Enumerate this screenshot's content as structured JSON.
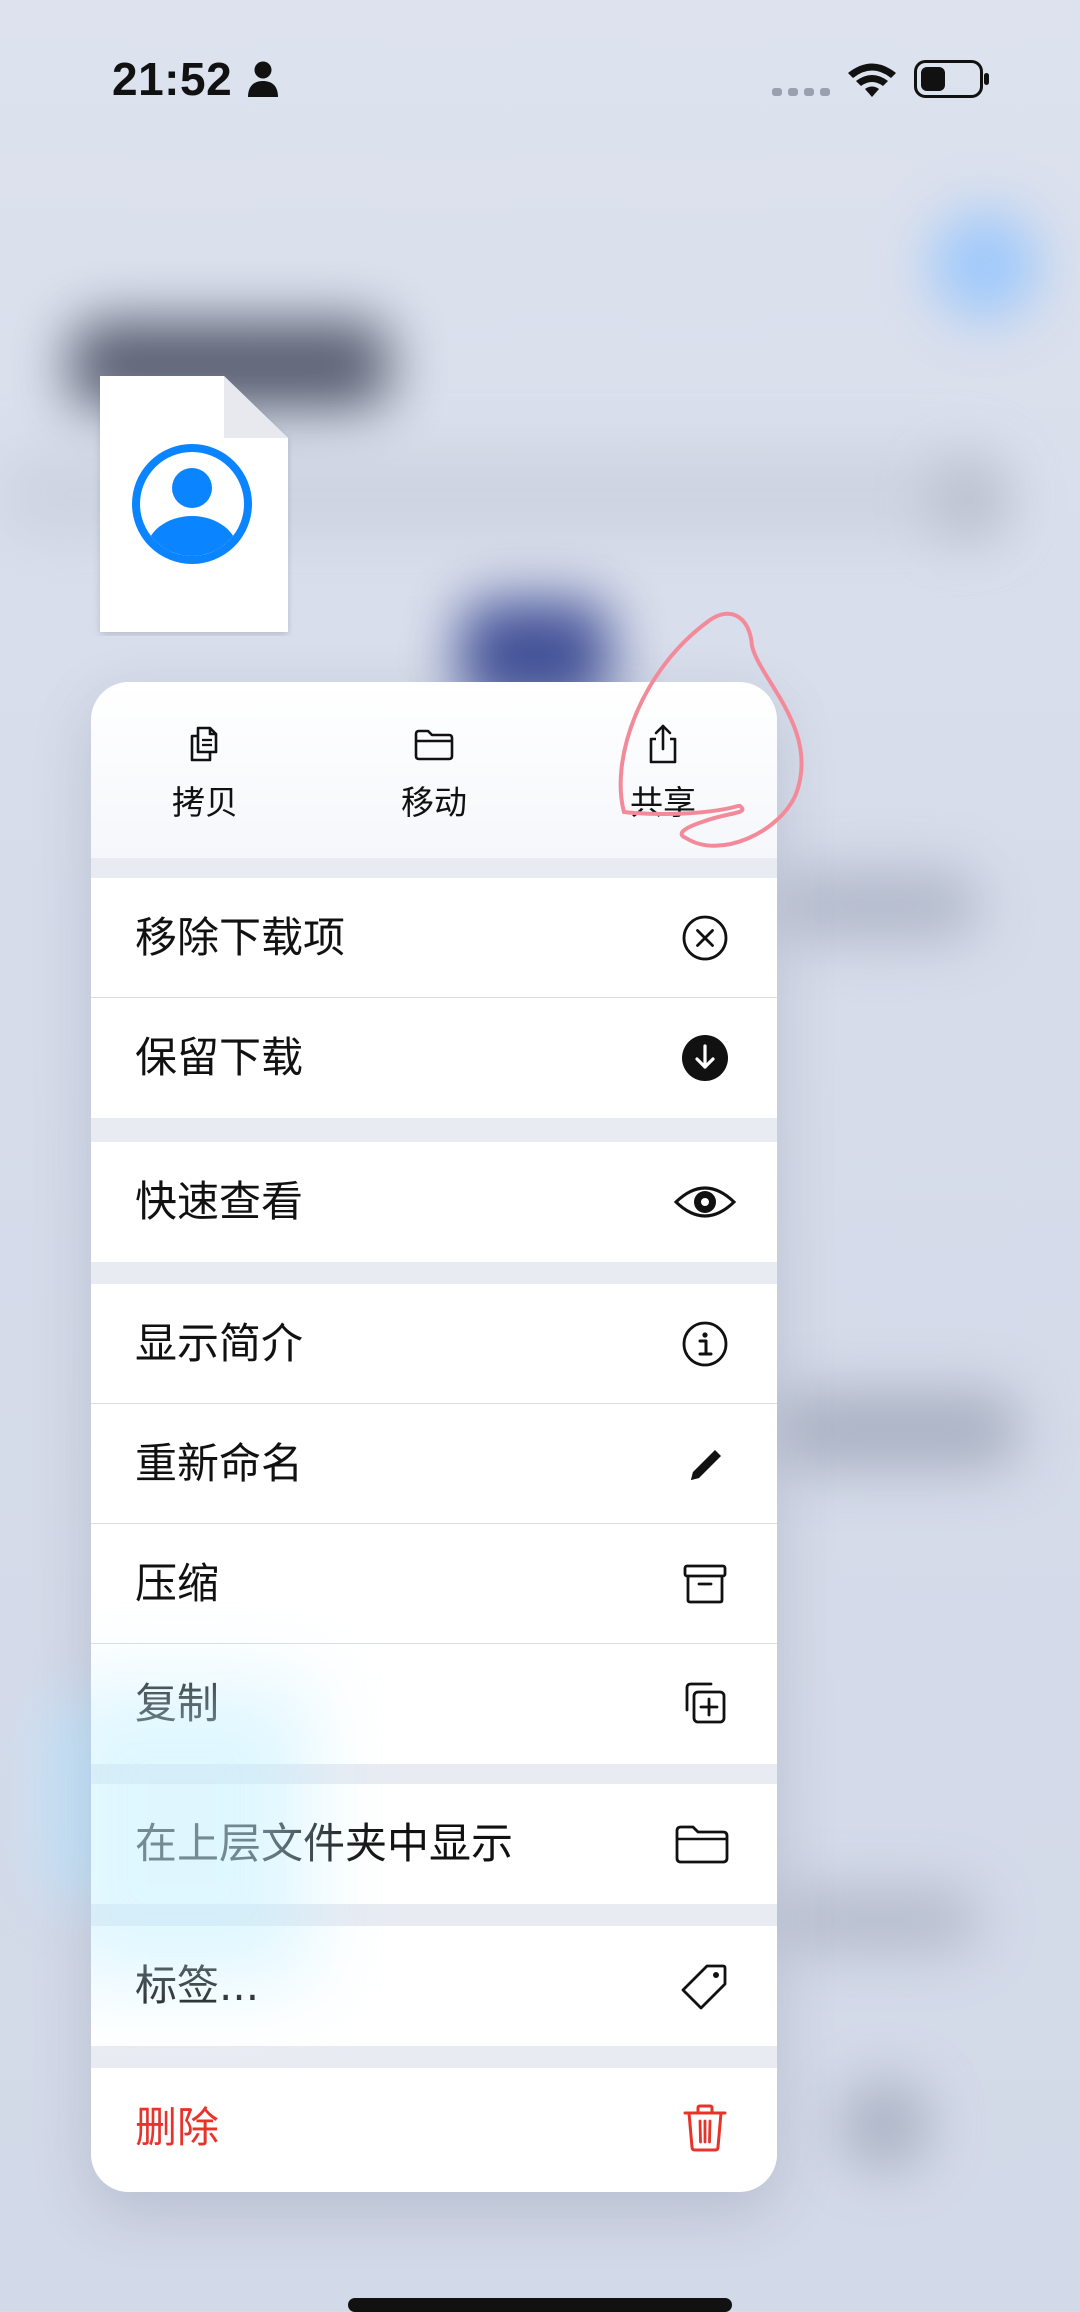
{
  "status_bar": {
    "time": "21:52"
  },
  "quick_actions": [
    {
      "label": "拷贝",
      "icon": "copy-icon"
    },
    {
      "label": "移动",
      "icon": "folder-icon"
    },
    {
      "label": "共享",
      "icon": "share-icon"
    }
  ],
  "menu_groups": [
    [
      {
        "label": "移除下载项",
        "icon": "xmark-circle-icon"
      },
      {
        "label": "保留下载",
        "icon": "download-circle-icon"
      }
    ],
    [
      {
        "label": "快速查看",
        "icon": "eye-icon"
      }
    ],
    [
      {
        "label": "显示简介",
        "icon": "info-circle-icon"
      },
      {
        "label": "重新命名",
        "icon": "pencil-icon"
      },
      {
        "label": "压缩",
        "icon": "archive-box-icon"
      },
      {
        "label": "复制",
        "icon": "duplicate-plus-icon"
      }
    ],
    [
      {
        "label": "在上层文件夹中显示",
        "icon": "folder-icon"
      }
    ],
    [
      {
        "label": "标签...",
        "icon": "tag-icon"
      }
    ],
    [
      {
        "label": "删除",
        "icon": "trash-icon"
      }
    ]
  ],
  "colors": {
    "accent": "#0a84ff",
    "danger": "#e8332b",
    "annotation": "#f28a9a"
  }
}
